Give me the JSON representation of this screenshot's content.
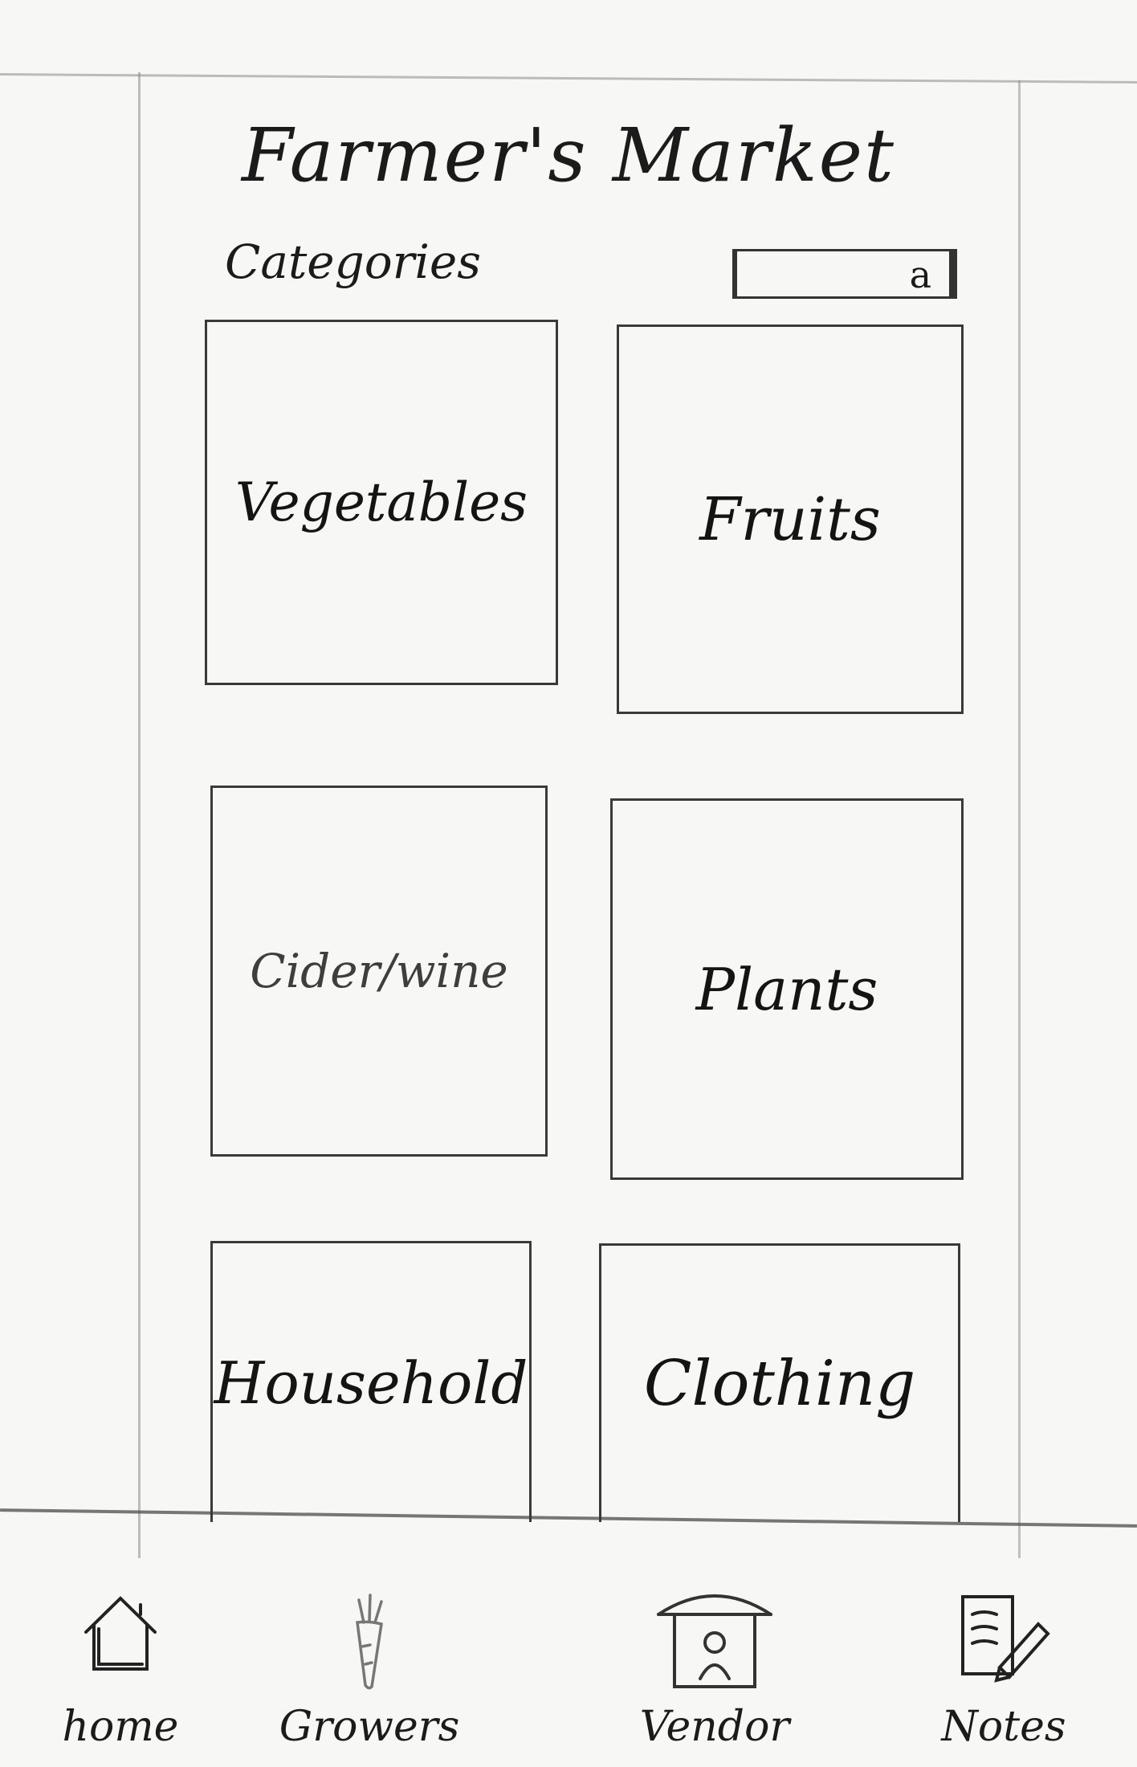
{
  "app": {
    "title": "Farmer's Market"
  },
  "categories": {
    "label": "Categories",
    "search": {
      "icon": "search-icon",
      "glyph": "a"
    },
    "tiles": [
      {
        "label": "Vegetables"
      },
      {
        "label": "Fruits"
      },
      {
        "label": "Cider/wine"
      },
      {
        "label": "Plants"
      },
      {
        "label": "Household"
      },
      {
        "label": "Clothing"
      }
    ]
  },
  "nav": {
    "items": [
      {
        "label": "home",
        "icon": "house-icon"
      },
      {
        "label": "Growers",
        "icon": "carrot-icon"
      },
      {
        "label": "Vendor",
        "icon": "market-stall-icon"
      },
      {
        "label": "Notes",
        "icon": "notepad-pencil-icon"
      }
    ]
  }
}
